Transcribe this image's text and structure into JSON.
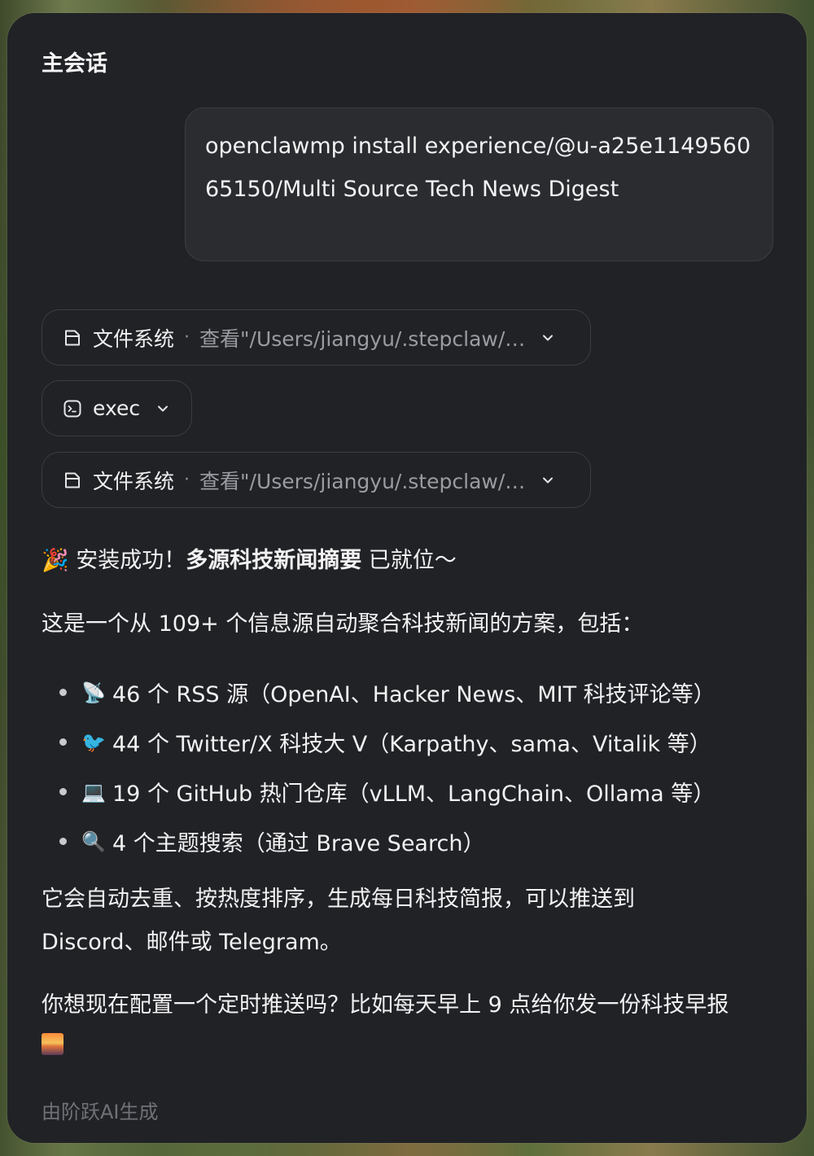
{
  "window": {
    "title": "主会话"
  },
  "user_message": {
    "text": "openclawmp install experience/@u-a25e114956065150/Multi Source Tech News Digest"
  },
  "tool_calls": [
    {
      "name": "文件系统",
      "separator": "·",
      "detail": "查看\"/Users/jiangyu/.stepclaw/…",
      "icon": "file-icon"
    },
    {
      "name": "exec",
      "separator": "",
      "detail": "",
      "icon": "terminal-icon"
    },
    {
      "name": "文件系统",
      "separator": "·",
      "detail": "查看\"/Users/jiangyu/.stepclaw/…",
      "icon": "file-icon"
    }
  ],
  "assistant": {
    "headline_prefix": "🎉 安装成功！",
    "headline_bold": "多源科技新闻摘要",
    "headline_suffix": " 已就位～",
    "intro": "这是一个从 109+ 个信息源自动聚合科技新闻的方案，包括：",
    "items": [
      {
        "emoji": "📡",
        "text": "46 个 RSS 源（OpenAI、Hacker News、MIT 科技评论等）"
      },
      {
        "emoji": "🐦",
        "text": "44 个 Twitter/X 科技大 V（Karpathy、sama、Vitalik 等）"
      },
      {
        "emoji": "💻",
        "text": "19 个 GitHub 热门仓库（vLLM、LangChain、Ollama 等）"
      },
      {
        "emoji": "🔍",
        "text": "4 个主题搜索（通过 Brave Search）"
      }
    ],
    "para2": "它会自动去重、按热度排序，生成每日科技简报，可以推送到 Discord、邮件或 Telegram。",
    "para3": "你想现在配置一个定时推送吗？比如每天早上 9 点给你发一份科技早报",
    "para3_emoji": "🌅"
  },
  "footer": {
    "text": "由阶跃AI生成"
  }
}
